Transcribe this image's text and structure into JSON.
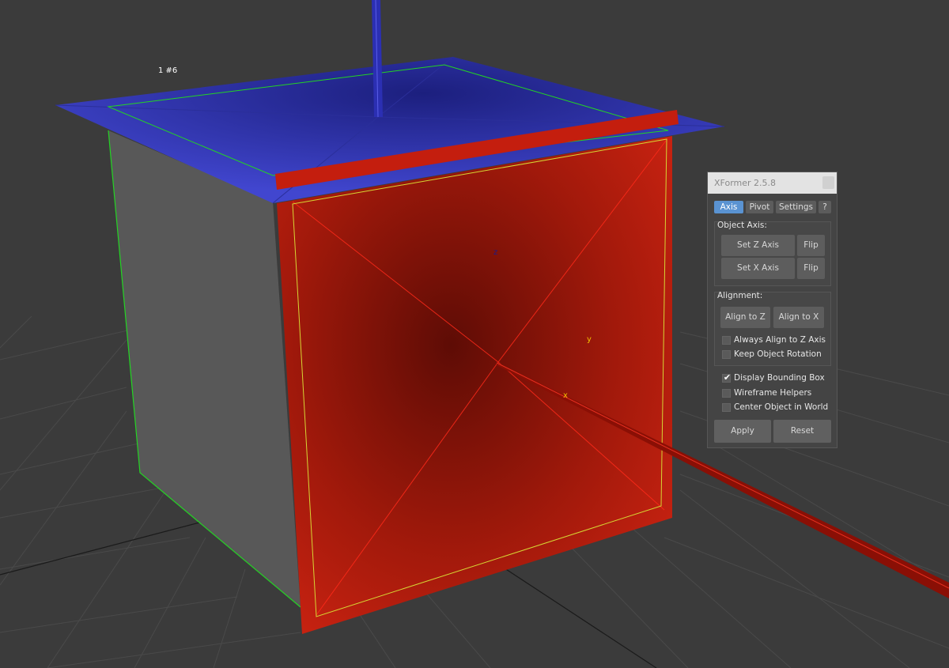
{
  "viewport": {
    "object_label": "1 #6",
    "axis_labels": {
      "z": "z",
      "y": "y",
      "x": "x"
    },
    "colors": {
      "background": "#3b3b3b",
      "grid": "#4a4a4a",
      "z_axis": "#3a3fc8",
      "x_axis": "#c41e0e",
      "side_face": "#585858",
      "bounding_edge": "#23d423"
    }
  },
  "panel": {
    "title": "XFormer 2.5.8",
    "close_icon": "close-icon",
    "tabs": [
      {
        "label": "Axis",
        "active": true
      },
      {
        "label": "Pivot",
        "active": false
      },
      {
        "label": "Settings",
        "active": false
      },
      {
        "label": "?",
        "active": false
      }
    ],
    "object_axis": {
      "label": "Object Axis:",
      "set_z": "Set Z Axis",
      "flip_z": "Flip",
      "set_x": "Set X Axis",
      "flip_x": "Flip"
    },
    "alignment": {
      "label": "Alignment:",
      "align_z": "Align to Z",
      "align_x": "Align to X",
      "options": [
        {
          "label": "Always Align to Z Axis",
          "checked": false
        },
        {
          "label": "Keep Object Rotation",
          "checked": false
        }
      ]
    },
    "options": [
      {
        "label": "Display Bounding Box",
        "checked": true
      },
      {
        "label": "Wireframe Helpers",
        "checked": false
      },
      {
        "label": "Center Object in World",
        "checked": false
      }
    ],
    "check_mark": "✔",
    "apply": "Apply",
    "reset": "Reset",
    "accent": "#5a93d2"
  }
}
